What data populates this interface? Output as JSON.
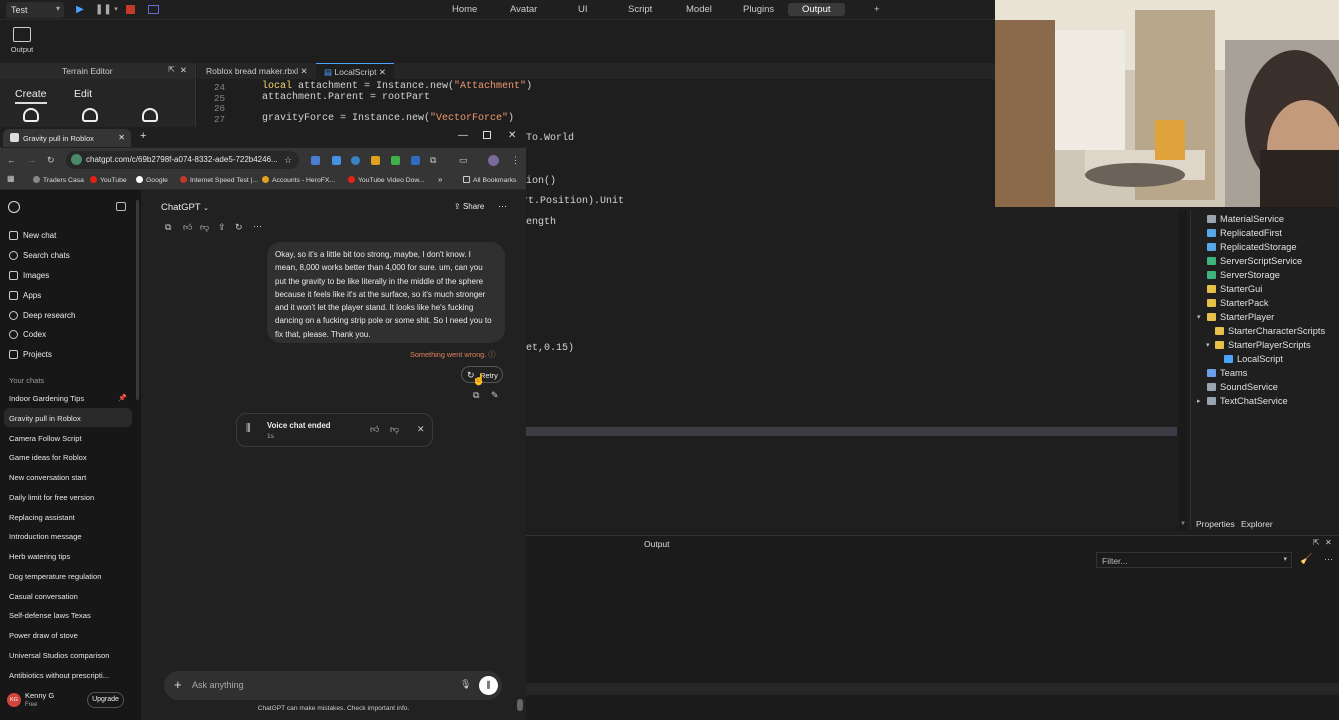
{
  "studio": {
    "test_dropdown": "Test",
    "tabs": [
      "Home",
      "Avatar",
      "UI",
      "Script",
      "Model",
      "Plugins",
      "Output"
    ],
    "active_tab": "Output",
    "plus": "+",
    "ribbon_output_label": "Output"
  },
  "terrain_editor": {
    "title": "Terrain Editor",
    "tabs": [
      "Create",
      "Edit"
    ]
  },
  "editor_tabs": [
    "Roblox bread maker.rbxl",
    "LocalScript"
  ],
  "code": {
    "line_numbers": [
      "24",
      "25",
      "26",
      "27"
    ],
    "lines": [
      {
        "kw": "local",
        "rest": " attachment = Instance.new(",
        "str": "\"Attachment\"",
        "end": ")"
      },
      {
        "kw": "",
        "rest": "attachment.Parent = rootPart",
        "str": "",
        "end": ""
      },
      {
        "kw": "",
        "rest": "",
        "str": "",
        "end": ""
      },
      {
        "kw": "",
        "rest": "gravityForce = Instance.new(",
        "str": "\"VectorForce\"",
        "end": ")"
      }
    ],
    "fragments": [
      "To.World",
      "ion()",
      "rt.Position).Unit",
      "ength",
      "et,0.15)"
    ]
  },
  "explorer": {
    "items": [
      "MaterialService",
      "ReplicatedFirst",
      "ReplicatedStorage",
      "ServerScriptService",
      "ServerStorage",
      "StarterGui",
      "StarterPack",
      "StarterPlayer",
      "StarterCharacterScripts",
      "StarterPlayerScripts",
      "LocalScript",
      "Teams",
      "SoundService",
      "TextChatService"
    ],
    "tabs": [
      "Properties",
      "Explorer"
    ]
  },
  "output_panel": {
    "title": "Output",
    "filter_placeholder": "Filter..."
  },
  "browser": {
    "tab_title": "Gravity pull in Roblox",
    "url": "chatgpt.com/c/69b2798f-a074-8332-ade5-722b4246...",
    "bookmarks": [
      "Traders Casa",
      "YouTube",
      "Google",
      "Internet Speed Test |...",
      "Accounts - HeroFX...",
      "YouTube Video Dow...",
      "All Bookmarks"
    ],
    "bookmark_more": "»"
  },
  "chatgpt": {
    "model": "ChatGPT",
    "share": "Share",
    "nav": [
      "New chat",
      "Search chats",
      "Images",
      "Apps",
      "Deep research",
      "Codex",
      "Projects"
    ],
    "your_chats_label": "Your chats",
    "chats": [
      "Indoor Gardening Tips",
      "Gravity pull in Roblox",
      "Camera Follow Script",
      "Game ideas for Roblox",
      "New conversation start",
      "Daily limit for free version",
      "Replacing assistant",
      "Introduction message",
      "Herb watering tips",
      "Dog temperature regulation",
      "Casual conversation",
      "Self-defense laws Texas",
      "Power draw of stove",
      "Universal Studios comparison",
      "Antibiotics without prescripti..."
    ],
    "user_message": "Okay, so it's a little bit too strong, maybe, I don't know. I mean, 8,000 works better than 4,000 for sure. um, can you put the gravity to be like literally in the middle of the sphere because it feels like it's at the surface, so it's much stronger and it won't let the player stand. It looks like he's fucking dancing on a fucking strip pole or some shit. So I need you to fix that, please. Thank you.",
    "error": "Something went wrong.",
    "retry": "Retry",
    "voice_title": "Voice chat ended",
    "voice_duration": "1s",
    "input_placeholder": "Ask anything",
    "footer": "ChatGPT can make mistakes. Check important info.",
    "user_name": "Kenny G",
    "user_plan": "Free",
    "user_initials": "KG",
    "upgrade": "Upgrade"
  },
  "colors": {
    "keyword": "#f8d66a",
    "string": "#ee9a6d",
    "error": "#e0805e",
    "accent": "#4aa3ff"
  }
}
